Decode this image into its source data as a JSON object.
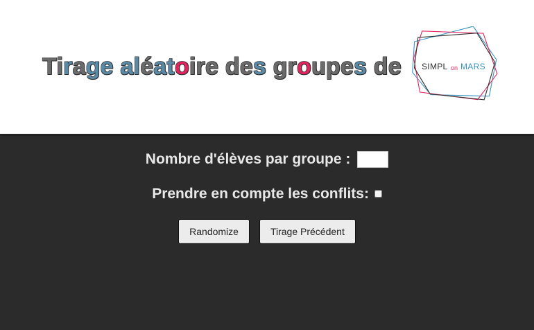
{
  "header": {
    "title_parts": [
      {
        "text": "Ti",
        "color": "#6b6b6b"
      },
      {
        "text": "r",
        "color": "#5a8aa6"
      },
      {
        "text": "a",
        "color": "#6b6b6b"
      },
      {
        "text": "ge ",
        "color": "#5a8aa6"
      },
      {
        "text": "al",
        "color": "#5a8aa6"
      },
      {
        "text": "é",
        "color": "#6b6b6b"
      },
      {
        "text": "at",
        "color": "#5a8aa6"
      },
      {
        "text": "o",
        "color": "#e0245e"
      },
      {
        "text": "ire ",
        "color": "#6b6b6b"
      },
      {
        "text": "de",
        "color": "#6b6b6b"
      },
      {
        "text": "s ",
        "color": "#5a8aa6"
      },
      {
        "text": "gr",
        "color": "#6b6b6b"
      },
      {
        "text": "o",
        "color": "#e0245e"
      },
      {
        "text": "upe",
        "color": "#6b6b6b"
      },
      {
        "text": "s ",
        "color": "#5a8aa6"
      },
      {
        "text": "de",
        "color": "#6b6b6b"
      }
    ],
    "logo": {
      "text_simpl": "SIMPL",
      "text_on": "on",
      "text_mars": "MARS",
      "colors": {
        "dark": "#2d2d2d",
        "pink": "#e0245e",
        "blue": "#3a93c1"
      }
    }
  },
  "form": {
    "group_size_label": "Nombre d'élèves par groupe :",
    "group_size_value": "",
    "conflicts_label": "Prendre en compte les conflits:",
    "conflicts_checked": false
  },
  "buttons": {
    "randomize": "Randomize",
    "previous": "Tirage Précédent"
  },
  "colors": {
    "header_bg": "#ffffff",
    "main_bg": "#2b2b2b",
    "main_text": "#e8e8e8"
  }
}
